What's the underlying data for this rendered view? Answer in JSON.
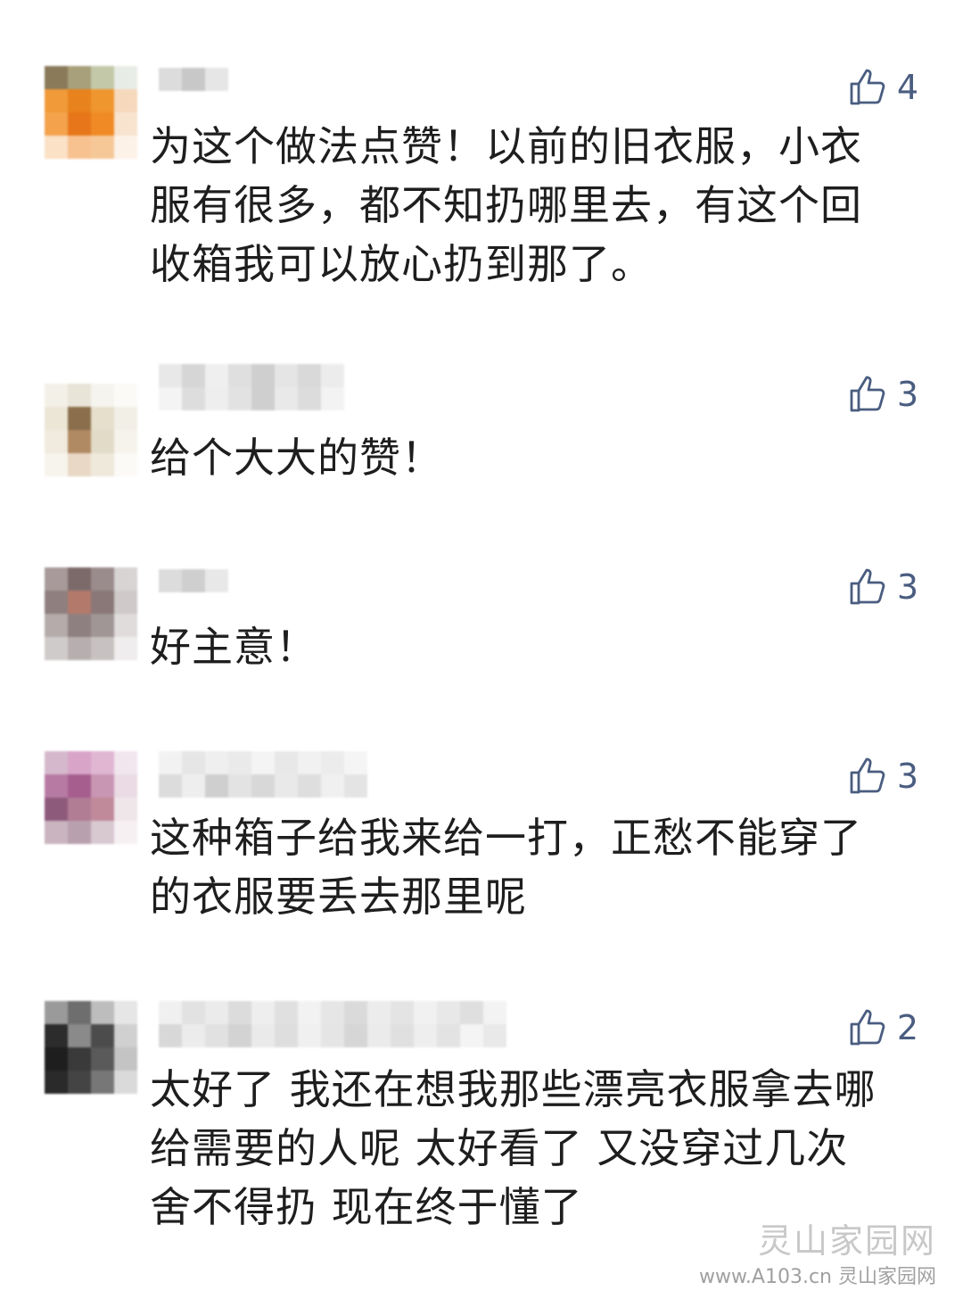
{
  "comments": [
    {
      "likes": "4",
      "text": "为这个做法点赞！以前的旧衣服，小衣\n服有很多，都不知扔哪里去，有这个回\n收箱我可以放心扔到那了。"
    },
    {
      "likes": "3",
      "text": "给个大大的赞！"
    },
    {
      "likes": "3",
      "text": "好主意！"
    },
    {
      "likes": "3",
      "text": "这种箱子给我来给一打，正愁不能穿了\n的衣服要丢去那里呢"
    },
    {
      "likes": "2",
      "text": "太好了 我还在想我那些漂亮衣服拿去哪\n给需要的人呢 太好看了 又没穿过几次\n舍不得扔 现在终于懂了"
    }
  ],
  "watermark": {
    "title": "灵山家园网",
    "url": "www.A103.cn 灵山家园网"
  },
  "icons": {
    "like": "thumbs-up-icon"
  },
  "colors": {
    "like": "#4a5d80",
    "text": "#1e1e1e"
  }
}
